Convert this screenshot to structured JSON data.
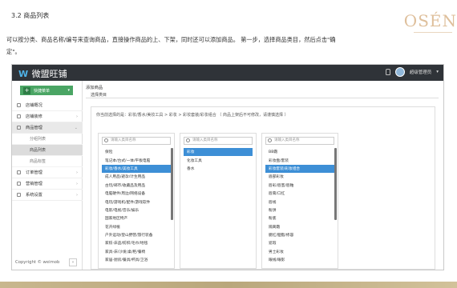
{
  "doc": {
    "heading": "3.2  商品列表",
    "paragraph": "可以按分类、商品名称/编号来查询商品，直接操作商品的上、下架，同时还可以添加商品。 第一步，选择商品类目，然后点击\"确",
    "paragraph_end": "定\"。",
    "brand": "OSÉN"
  },
  "app": {
    "logo_name": "微盟旺铺",
    "user_name": "超级管理员",
    "create_button": "快捷菜单",
    "copyright": "Copyright © weimob"
  },
  "nav": [
    {
      "label": "店铺概况"
    },
    {
      "label": "店铺装修"
    },
    {
      "label": "商品管理"
    },
    {
      "label": "订单管理"
    },
    {
      "label": "营销管理"
    },
    {
      "label": "系统设置"
    }
  ],
  "nav_sub": [
    {
      "label": "分组列表"
    },
    {
      "label": "商品列表"
    },
    {
      "label": "商品标签"
    }
  ],
  "content": {
    "breadcrumb": "添加商品",
    "tab": "选择类目",
    "panel_title": "你当前选择的是：彩妆/香水/美妆工具 > 彩妆 > 彩妆套装/彩妆组合 （ 商品上架后不可修改，请谨慎选择 ）",
    "search_placeholder": "请输入类目名称"
  },
  "category_cols": [
    {
      "items": [
        "保险",
        "笔记本/台式/一体/平板电脑",
        "彩妆/香水/美妆工具",
        "成人用品/避孕/计生用品",
        "古玩/邮币/收藏品及用品",
        "电脑硬件/周边/网络设备",
        "电玩/游戏机/配件/游戏软件",
        "电影/电视/音乐/娱乐",
        "国家地区特产",
        "花卉绿植",
        "户外运动/登山野营/旅行装备",
        "家纺-床品/纺织/毛巾/地毯",
        "家具-床/沙发/桌/柜/餐椅",
        "家居-厨房/餐具/杯具/卫浴"
      ],
      "selected": 2
    },
    {
      "items": [
        "彩妆",
        "化妆工具",
        "香水"
      ],
      "selected": 0
    },
    {
      "items": [
        "BB霜",
        "彩妆盘/套装",
        "彩妆套装/彩妆组合",
        "眉部彩妆",
        "唇彩/唇蜜/唇釉",
        "唇膏/口红",
        "唇线",
        "粉饼",
        "粉底",
        "隔离霜",
        "腮红/胭脂/修容",
        "遮瑕",
        "男士彩妆",
        "眼线/眼影"
      ],
      "selected": 2
    }
  ]
}
